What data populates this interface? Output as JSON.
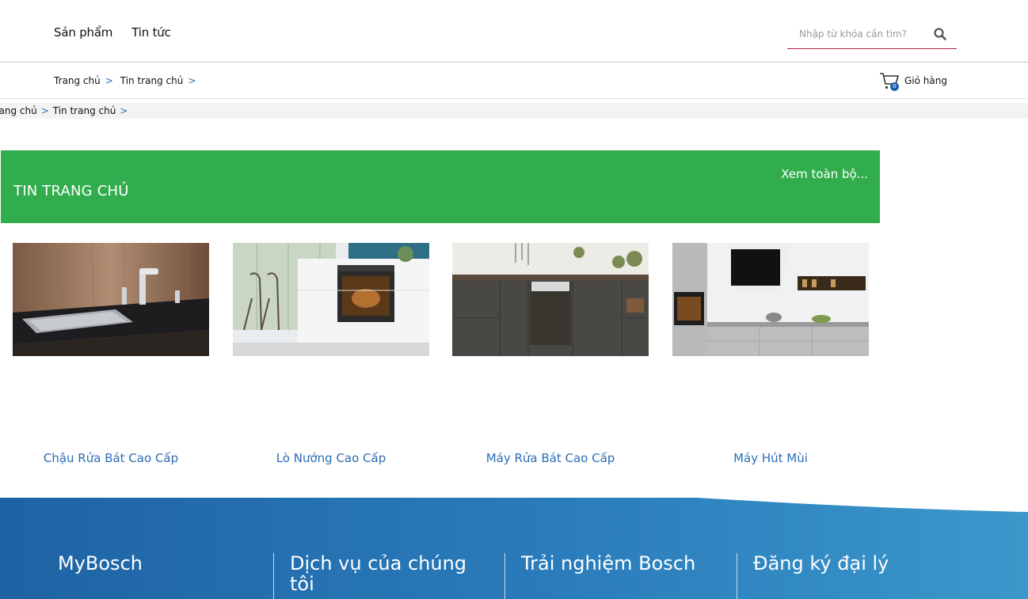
{
  "header": {
    "nav": [
      {
        "label": "Sản phẩm"
      },
      {
        "label": "Tin tức"
      }
    ],
    "search": {
      "placeholder": "Nhập từ khóa cần tìm?"
    }
  },
  "breadcrumb": {
    "items": [
      "Trang chủ",
      "Tin trang chủ"
    ],
    "sep": ">"
  },
  "cart": {
    "label": "Giỏ hàng",
    "count": "0"
  },
  "breadcrumb2": {
    "items": [
      "Trang chủ",
      "Tin trang chủ"
    ],
    "sep": ">"
  },
  "banner": {
    "title": "TIN TRANG CHỦ",
    "view_all": "Xem toàn bộ..."
  },
  "products": [
    {
      "title": "Chậu Rửa Bát Cao Cấp"
    },
    {
      "title": "Lò Nướng Cao Cấp"
    },
    {
      "title": "Máy Rửa Bát Cao Cấp"
    },
    {
      "title": "Máy Hút Mùi"
    }
  ],
  "footer": {
    "columns": [
      {
        "title": "MyBosch"
      },
      {
        "title": "Dịch vụ của chúng tôi"
      },
      {
        "title": "Trải nghiệm Bosch"
      },
      {
        "title": "Đăng ký đại lý"
      }
    ]
  },
  "colors": {
    "banner_green": "#32ad4e",
    "link_blue": "#2c6db3",
    "search_underline": "#b3263e",
    "footer_blue": "#1e63a4"
  }
}
